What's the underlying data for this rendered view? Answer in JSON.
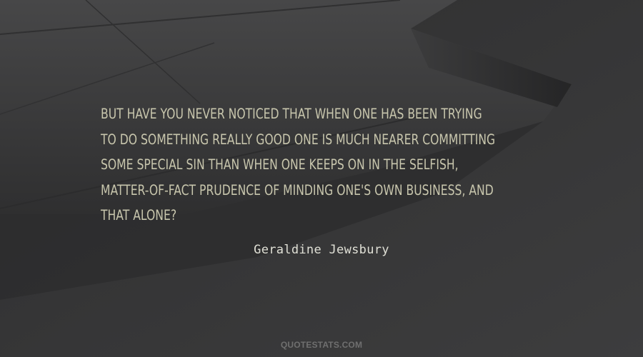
{
  "quote": {
    "lines": [
      "But have you never noticed that when one has been trying",
      "to do something really good one is much nearer committing",
      "some special sin than when one keeps on in the selfish,",
      "matter-of-fact prudence of minding one's own business, and",
      "that alone?"
    ]
  },
  "author": "Geraldine Jewsbury",
  "watermark": "QUOTESTATS.COM",
  "colors": {
    "background": "#3a3a3b",
    "quote_text": "#c8c6ad",
    "author_text": "#e0e0d6",
    "watermark_text": "#6f6f6f"
  }
}
